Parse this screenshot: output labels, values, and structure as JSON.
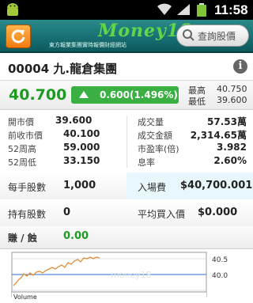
{
  "statusbar": {
    "time": "11:58"
  },
  "header": {
    "brand": "Money18",
    "tagline": "東方報業集團實時報價財經網站",
    "search_label": "查詢股價"
  },
  "stock": {
    "code_name": "00004 九.龍倉集團"
  },
  "quote": {
    "price": "40.700",
    "change": "0.600(1.496%)",
    "high_label": "最高",
    "high": "40.750",
    "low_label": "最低",
    "low": "39.600",
    "price_color": "#1e9a23",
    "up_color": "#3ab042"
  },
  "stats_left": [
    {
      "label": "開市價",
      "value": "39.600"
    },
    {
      "label": "前收市價",
      "value": "40.100"
    },
    {
      "label": "52周高",
      "value": "59.000"
    },
    {
      "label": "52周低",
      "value": "33.150"
    }
  ],
  "stats_right": [
    {
      "label": "成交量",
      "value": "57.53萬"
    },
    {
      "label": "成交金額",
      "value": "2,314.65萬"
    },
    {
      "label": "市盈率(倍)",
      "value": "3.982"
    },
    {
      "label": "息率",
      "value": "2.60%"
    }
  ],
  "trade": {
    "lot_label": "每手股數",
    "lot_value": "1,000",
    "entry_label": "入場費",
    "entry_value": "$40,700.001",
    "hold_label": "持有股數",
    "hold_value": "0",
    "avg_label": "平均買入價",
    "avg_value": "$0.000",
    "pl_label": "賺 / 蝕",
    "pl_value": "0.00"
  },
  "chart": {
    "y_high": "40.5",
    "y_mid": "40.0",
    "volume_label": "Volume",
    "watermark": "money18"
  }
}
